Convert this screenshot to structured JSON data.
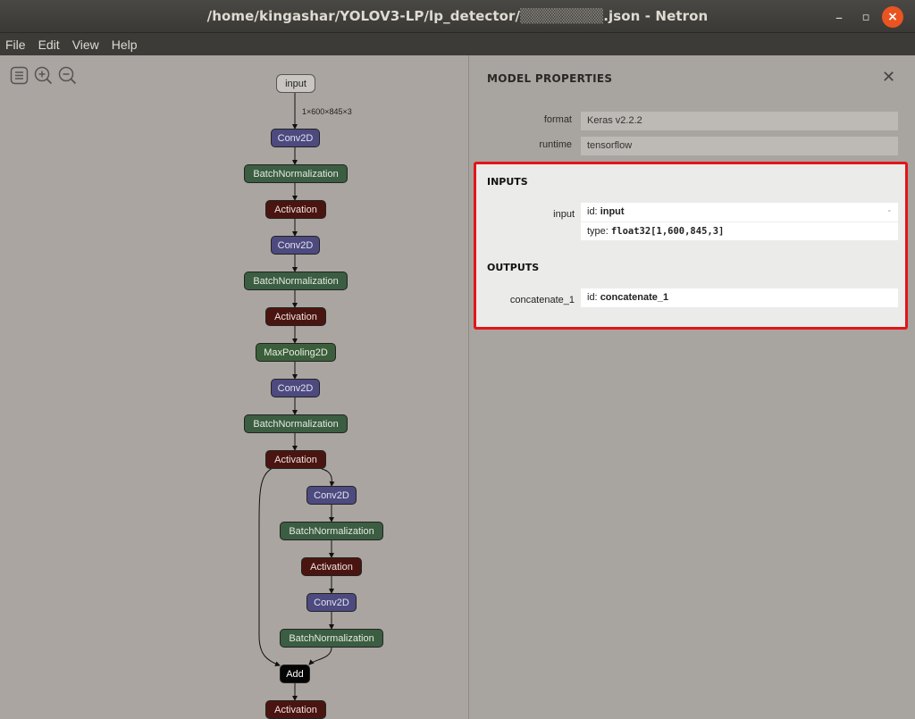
{
  "window": {
    "title": "/home/kingashar/YOLOV3-LP/lp_detector/",
    "title_suffix": ".json - Netron",
    "close_label": "×",
    "minimize_label": "–",
    "maximize_label": "▫"
  },
  "menu": [
    "File",
    "Edit",
    "View",
    "Help"
  ],
  "graph": {
    "tools": [
      "list-icon",
      "zoom-in-icon",
      "zoom-out-icon"
    ],
    "edge_label": "1×600×845×3",
    "nodes": [
      {
        "label": "input",
        "kind": "input"
      },
      {
        "label": "Conv2D",
        "kind": "layer"
      },
      {
        "label": "BatchNormalization",
        "kind": "norm"
      },
      {
        "label": "Activation",
        "kind": "act"
      },
      {
        "label": "Conv2D",
        "kind": "layer"
      },
      {
        "label": "BatchNormalization",
        "kind": "norm"
      },
      {
        "label": "Activation",
        "kind": "act"
      },
      {
        "label": "MaxPooling2D",
        "kind": "pool"
      },
      {
        "label": "Conv2D",
        "kind": "layer"
      },
      {
        "label": "BatchNormalization",
        "kind": "norm"
      },
      {
        "label": "Activation",
        "kind": "act"
      },
      {
        "label": "Conv2D",
        "kind": "layer"
      },
      {
        "label": "BatchNormalization",
        "kind": "norm"
      },
      {
        "label": "Activation",
        "kind": "act"
      },
      {
        "label": "Conv2D",
        "kind": "layer"
      },
      {
        "label": "BatchNormalization",
        "kind": "norm"
      },
      {
        "label": "Add",
        "kind": "add"
      },
      {
        "label": "Activation",
        "kind": "act"
      }
    ]
  },
  "sidebar": {
    "title": "MODEL PROPERTIES",
    "close_label": "✕",
    "properties": [
      {
        "name": "format",
        "value": "Keras v2.2.2"
      },
      {
        "name": "runtime",
        "value": "tensorflow"
      }
    ],
    "inputs_title": "INPUTS",
    "input": {
      "name": "input",
      "id_prefix": "id:",
      "id": "input",
      "type_prefix": "type:",
      "type": "float32[1,600,845,3]",
      "expand": "-"
    },
    "outputs_title": "OUTPUTS",
    "output": {
      "name": "concatenate_1",
      "id_prefix": "id:",
      "id": "concatenate_1"
    }
  }
}
